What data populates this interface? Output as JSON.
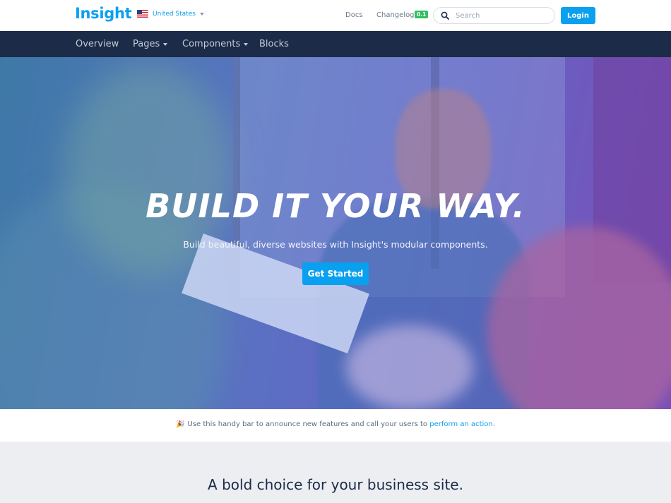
{
  "brand": {
    "logo": "Insight"
  },
  "locale": {
    "label": "United States"
  },
  "toplinks": {
    "docs": "Docs",
    "changelog": "Changelog",
    "changelog_badge": "0.1"
  },
  "search": {
    "placeholder": "Search"
  },
  "auth": {
    "login": "Login"
  },
  "nav": {
    "items": [
      {
        "label": "Overview"
      },
      {
        "label": "Pages"
      },
      {
        "label": "Components"
      },
      {
        "label": "Blocks"
      }
    ]
  },
  "hero": {
    "title": "Build it your way.",
    "subtitle": "Build beautiful, diverse websites with Insight's modular components.",
    "cta": "Get Started"
  },
  "announcement": {
    "icon": "🎉",
    "text": "Use this handy bar to announce new features and call your users to ",
    "link": "perform an action",
    "suffix": "."
  },
  "section": {
    "heading": "A bold choice for your business site."
  },
  "colors": {
    "accent": "#0aa0f0",
    "nav_bg": "#1c2b47",
    "badge": "#2fbf5e"
  }
}
